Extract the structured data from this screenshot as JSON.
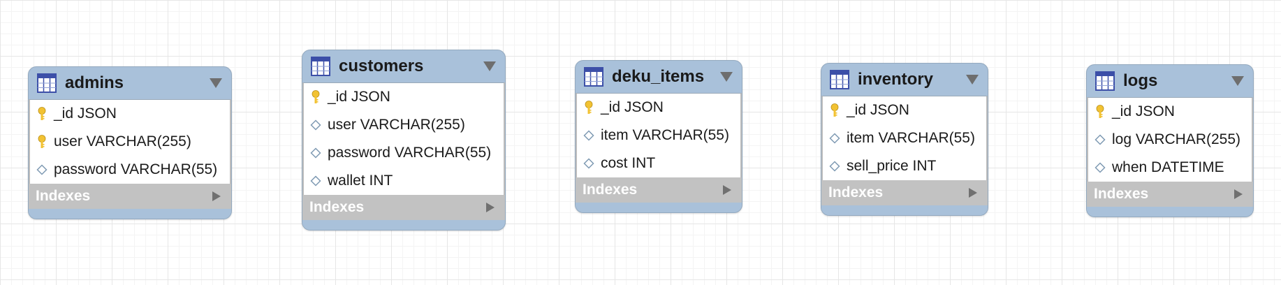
{
  "tables": [
    {
      "name": "admins",
      "columns": [
        {
          "text": "_id JSON",
          "icon": "key-icon"
        },
        {
          "text": "user VARCHAR(255)",
          "icon": "key-icon"
        },
        {
          "text": "password VARCHAR(55)",
          "icon": "diamond-icon"
        }
      ],
      "indexes_label": "Indexes"
    },
    {
      "name": "customers",
      "columns": [
        {
          "text": "_id JSON",
          "icon": "key-icon"
        },
        {
          "text": "user VARCHAR(255)",
          "icon": "diamond-icon"
        },
        {
          "text": "password VARCHAR(55)",
          "icon": "diamond-icon"
        },
        {
          "text": "wallet INT",
          "icon": "diamond-icon"
        }
      ],
      "indexes_label": "Indexes"
    },
    {
      "name": "deku_items",
      "columns": [
        {
          "text": "_id JSON",
          "icon": "key-icon"
        },
        {
          "text": "item VARCHAR(55)",
          "icon": "diamond-icon"
        },
        {
          "text": "cost INT",
          "icon": "diamond-icon"
        }
      ],
      "indexes_label": "Indexes"
    },
    {
      "name": "inventory",
      "columns": [
        {
          "text": "_id JSON",
          "icon": "key-icon"
        },
        {
          "text": "item VARCHAR(55)",
          "icon": "diamond-icon"
        },
        {
          "text": "sell_price INT",
          "icon": "diamond-icon"
        }
      ],
      "indexes_label": "Indexes"
    },
    {
      "name": "logs",
      "columns": [
        {
          "text": "_id JSON",
          "icon": "key-icon"
        },
        {
          "text": "log VARCHAR(255)",
          "icon": "diamond-icon"
        },
        {
          "text": "when DATETIME",
          "icon": "diamond-icon"
        }
      ],
      "indexes_label": "Indexes"
    }
  ],
  "colors": {
    "header_bg": "#a9c1da",
    "indexes_bg": "#c2c2c2",
    "key_icon": "#f2c232",
    "diamond_icon": "#7f9ab3"
  }
}
